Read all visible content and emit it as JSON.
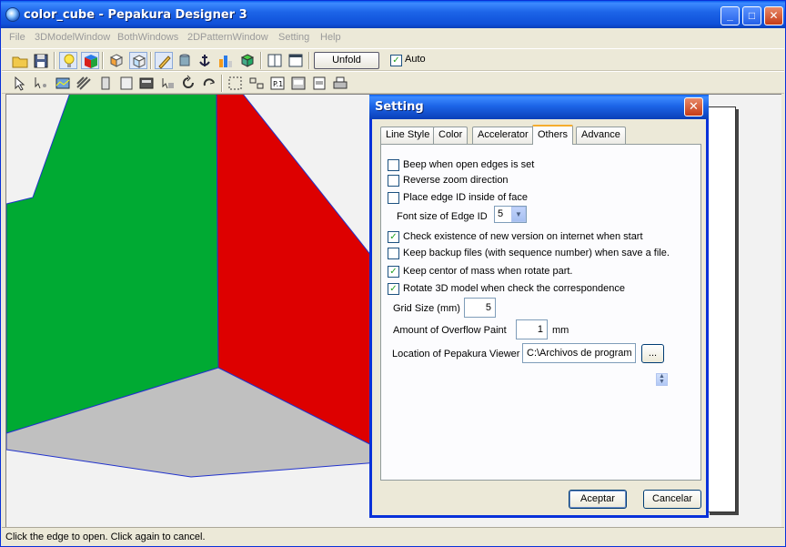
{
  "window": {
    "title": "color_cube - Pepakura Designer 3",
    "minimize": "_",
    "maximize": "□",
    "close": "✕"
  },
  "menu": [
    "File",
    "3DModelWindow",
    "BothWindows",
    "2DPatternWindow",
    "Setting",
    "Help"
  ],
  "toolbar": {
    "unfold_label": "Unfold",
    "auto_label": "Auto",
    "auto_checked": "✓"
  },
  "status": {
    "text": "Click the edge to open. Click again to cancel."
  },
  "cube_colors": {
    "left_face": "#00AA33",
    "right_face": "#DD0000",
    "bottom_face": "#C0C0C0",
    "edge": "#2233CC"
  },
  "dialog": {
    "title": "Setting",
    "close": "✕",
    "tabs": [
      "Line Style",
      "Color",
      "Accelerator",
      "Others",
      "Advance"
    ],
    "active_tab": "Others",
    "options": {
      "beep_open_edges": {
        "label": "Beep when open edges is set",
        "checked": ""
      },
      "reverse_zoom": {
        "label": "Reverse zoom direction",
        "checked": ""
      },
      "edge_id_inside": {
        "label": "Place edge ID inside of face",
        "checked": ""
      },
      "font_size_label": "Font size of Edge ID",
      "font_size_value": "5",
      "check_version": {
        "label": "Check existence of new version on internet when start",
        "checked": "✓"
      },
      "keep_backup": {
        "label": "Keep backup files (with sequence number) when save a file.",
        "checked": ""
      },
      "keep_center": {
        "label": "Keep centor of mass when rotate part.",
        "checked": "✓"
      },
      "rotate_3d": {
        "label": "Rotate 3D model when check the correspondence",
        "checked": "✓"
      },
      "grid_size_label": "Grid Size (mm)",
      "grid_size_value": "5",
      "overflow_label": "Amount of Overflow Paint",
      "overflow_value": "1",
      "overflow_unit": "mm",
      "viewer_label": "Location of Pepakura Viewer",
      "viewer_value": "C:\\Archivos de program",
      "browse_label": "..."
    },
    "ok_label": "Aceptar",
    "cancel_label": "Cancelar"
  }
}
